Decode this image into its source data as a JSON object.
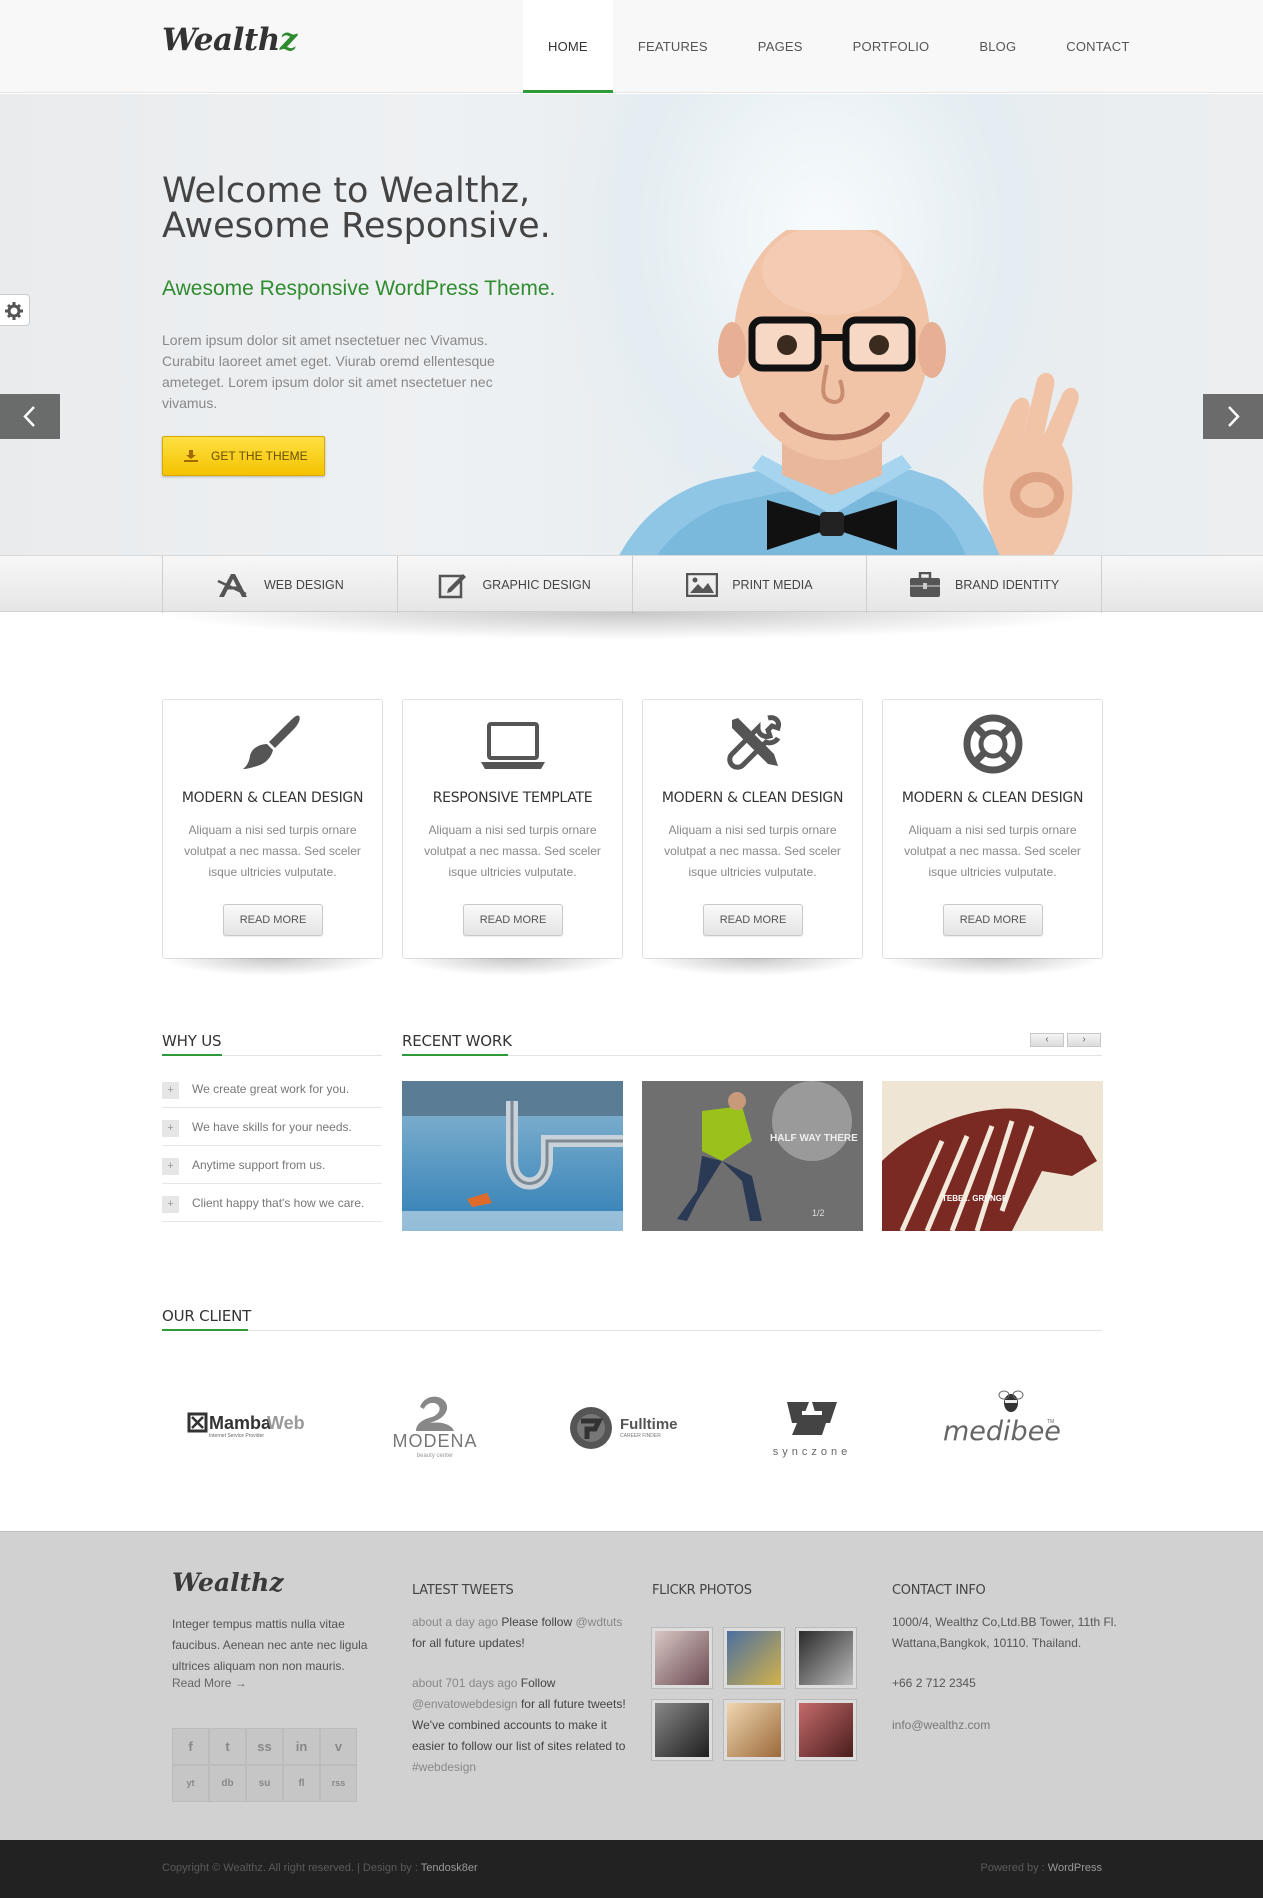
{
  "header": {
    "logo": "Wealth",
    "logo_accent": "z",
    "nav": [
      "HOME",
      "FEATURES",
      "PAGES",
      "PORTFOLIO",
      "BLOG",
      "CONTACT"
    ],
    "active_nav": "HOME",
    "accent_color": "#2e9a3a"
  },
  "hero": {
    "title_line1": "Welcome to Wealthz,",
    "title_line2": "Awesome Responsive.",
    "subtitle": "Awesome Responsive WordPress Theme.",
    "text": "Lorem ipsum dolor sit amet nsectetuer nec Vivamus. Curabitu laoreet amet eget. Viurab oremd ellentesque ameteget. Lorem ipsum dolor sit amet nsectetuer nec vivamus.",
    "button": "GET THE THEME",
    "button_color": "#f4c300"
  },
  "services": [
    {
      "label": "WEB DESIGN",
      "icon": "web-design-icon"
    },
    {
      "label": "GRAPHIC DESIGN",
      "icon": "pen-edit-icon"
    },
    {
      "label": "PRINT MEDIA",
      "icon": "image-icon"
    },
    {
      "label": "BRAND IDENTITY",
      "icon": "briefcase-icon"
    }
  ],
  "features": [
    {
      "title": "MODERN & CLEAN DESIGN",
      "text": "Aliquam a nisi sed turpis ornare volutpat a nec massa. Sed sceler isque ultricies vulputate.",
      "button": "READ MORE",
      "icon": "paintbrush-icon"
    },
    {
      "title": "RESPONSIVE TEMPLATE",
      "text": "Aliquam a nisi sed turpis ornare volutpat a nec massa. Sed sceler isque ultricies vulputate.",
      "button": "READ MORE",
      "icon": "laptop-icon"
    },
    {
      "title": "MODERN & CLEAN DESIGN",
      "text": "Aliquam a nisi sed turpis ornare volutpat a nec massa. Sed sceler isque ultricies vulputate.",
      "button": "READ MORE",
      "icon": "tools-icon"
    },
    {
      "title": "MODERN & CLEAN DESIGN",
      "text": "Aliquam a nisi sed turpis ornare volutpat a nec massa. Sed sceler isque ultricies vulputate.",
      "button": "READ MORE",
      "icon": "lifebuoy-icon"
    }
  ],
  "why_us": {
    "heading": "WHY US",
    "items": [
      "We create great work for you.",
      "We have skills for your needs.",
      "Anytime support from us.",
      "Client happy that's how we care."
    ]
  },
  "recent_work": {
    "heading": "RECENT WORK",
    "prev": "‹",
    "next": "›",
    "items": [
      {
        "caption": ""
      },
      {
        "caption": "HALF WAY THERE",
        "sub": "1/2"
      },
      {
        "caption": "TEBE... GRUNGE"
      }
    ]
  },
  "clients": {
    "heading": "OUR CLIENT",
    "logos": [
      {
        "name": "MambaWeb",
        "part1": "Mamba",
        "part2": "Web",
        "tagline": "Internet Service Provider"
      },
      {
        "name": "MODENA",
        "tagline": "beauty center"
      },
      {
        "name": "Fulltime",
        "tagline": "CAREER FINDER"
      },
      {
        "name": "synczone"
      },
      {
        "name": "medibee",
        "tm": "TM"
      }
    ]
  },
  "footer": {
    "logo": "Wealthz",
    "about": "Integer tempus mattis nulla vitae faucibus. Aenean nec ante nec ligula ultrices aliquam non non mauris.",
    "read_more": "Read More →",
    "social": [
      "f",
      "t",
      "ss",
      "in",
      "v",
      "yt",
      "db",
      "su",
      "fl",
      "rss"
    ],
    "tweets_heading": "LATEST TWEETS",
    "tweets": [
      {
        "meta": "about a day ago",
        "pre": "Please follow",
        "handle": "@wdtuts",
        "post": "for all future updates!"
      },
      {
        "meta": "about 701 days ago",
        "pre": "Follow",
        "handle": "@envatowebdesign",
        "post": "for all future tweets! We've combined accounts to make it easier to follow our list of sites related to",
        "tag": "#webdesign"
      }
    ],
    "flickr_heading": "FLICKR PHOTOS",
    "contact_heading": "CONTACT INFO",
    "address": "1000/4, Wealthz Co,Ltd.BB Tower, 11th Fl. Wattana,Bangkok, 10110. Thailand.",
    "phone": "+66 2 712 2345",
    "email": "info@wealthz.com"
  },
  "bottom": {
    "copyright": "Copyright © Wealthz. All right reserved. | Design by :",
    "designer": "Tendosk8er",
    "powered": "Powered by :",
    "platform": "WordPress"
  }
}
